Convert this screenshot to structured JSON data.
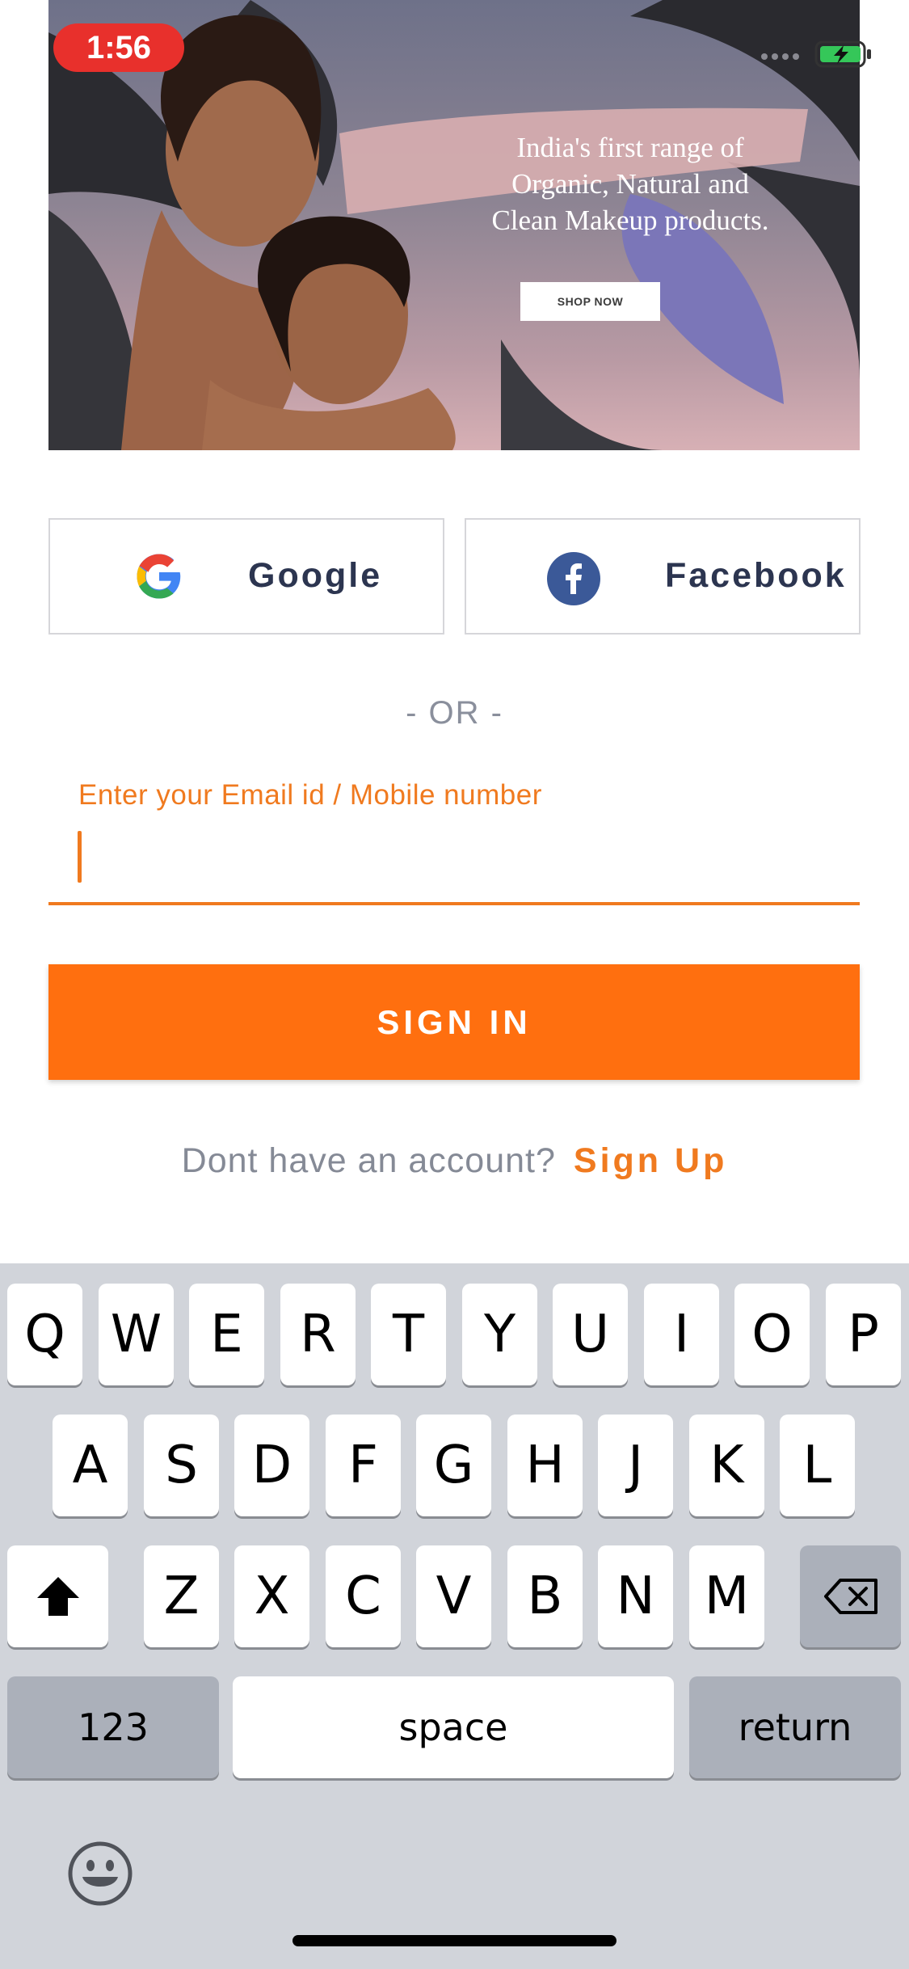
{
  "status_bar": {
    "time": "1:56"
  },
  "banner": {
    "headline_lines": [
      "India's first range of",
      "Organic, Natural and",
      "Clean Makeup products."
    ],
    "cta": "SHOP NOW"
  },
  "social": {
    "google_label": "Google",
    "facebook_label": "Facebook"
  },
  "divider_text": "- OR -",
  "login": {
    "field_label": "Enter your Email id / Mobile number",
    "value": "",
    "sign_in_label": "SIGN IN",
    "no_account_text": "Dont have an account?",
    "sign_up_label": "Sign Up"
  },
  "keyboard": {
    "row1": [
      "Q",
      "W",
      "E",
      "R",
      "T",
      "Y",
      "U",
      "I",
      "O",
      "P"
    ],
    "row2": [
      "A",
      "S",
      "D",
      "F",
      "G",
      "H",
      "J",
      "K",
      "L"
    ],
    "row3": [
      "Z",
      "X",
      "C",
      "V",
      "B",
      "N",
      "M"
    ],
    "numbers_key": "123",
    "space_key": "space",
    "return_key": "return"
  },
  "colors": {
    "accent": "#ff6f0f",
    "label_orange": "#f07a1f",
    "time_pill": "#e8302c",
    "facebook_blue": "#3b5998",
    "keyboard_bg": "#d1d4da"
  }
}
